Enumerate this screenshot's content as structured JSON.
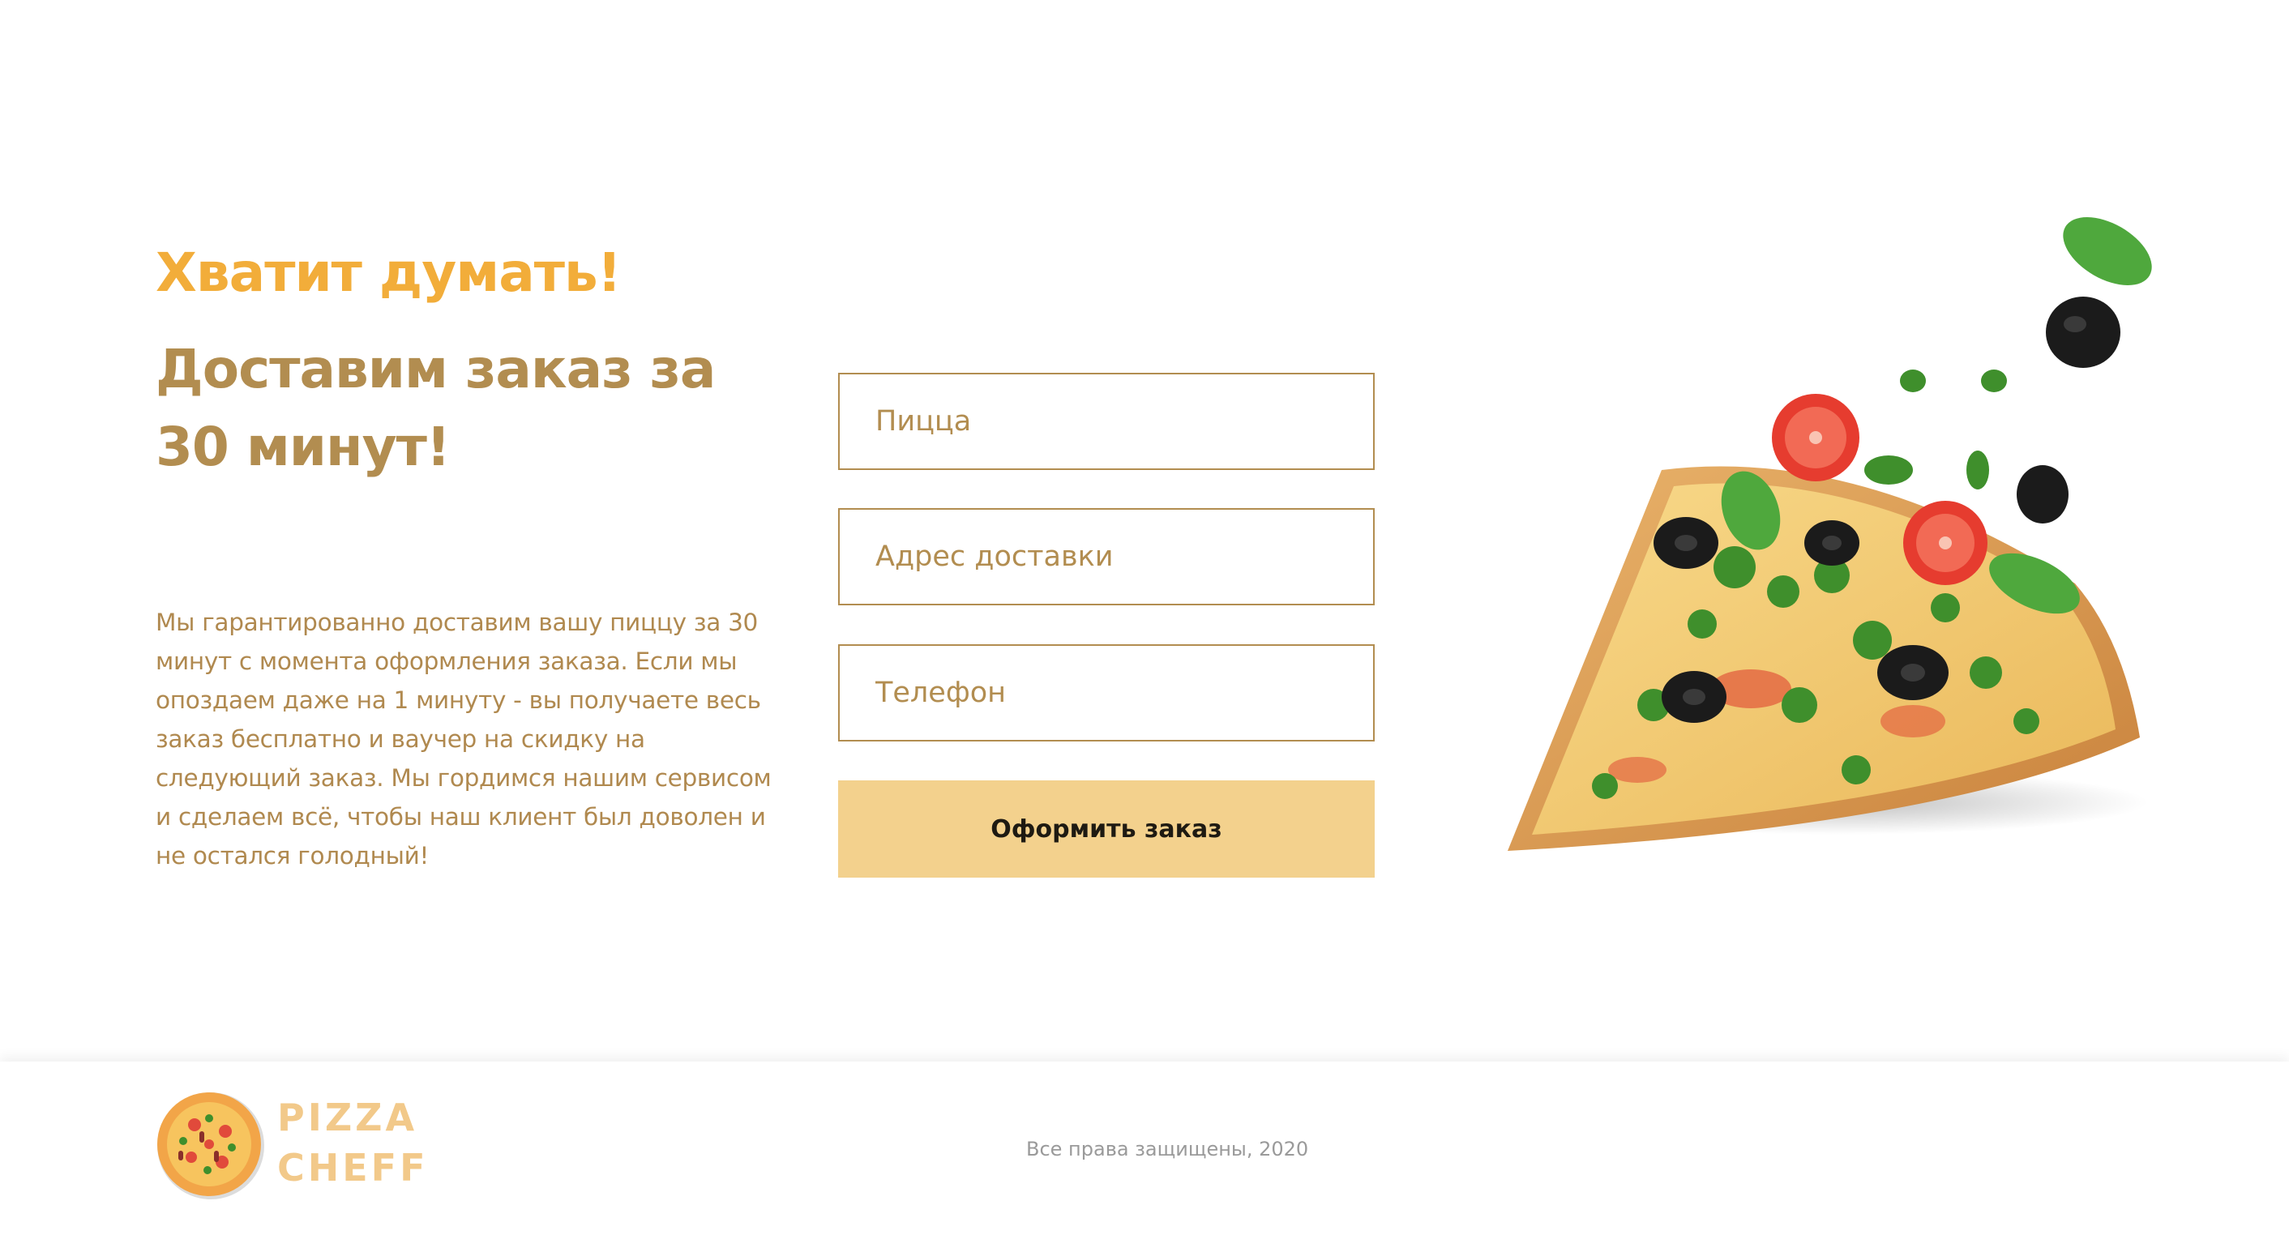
{
  "hero": {
    "headline": "Хватит думать!",
    "subheadline": "Доставим заказ за 30 минут!",
    "description": "Мы гарантированно доставим вашу пиццу за 30 минут с момента оформления заказа. Если мы опоздаем даже на 1 минуту - вы получаете весь заказ бесплатно и ваучер на скидку на следующий заказ. Мы гордимся нашим сервисом и сделаем всё, чтобы наш клиент был доволен и не остался голодный!"
  },
  "form": {
    "pizza_placeholder": "Пицца",
    "pizza_value": "",
    "address_placeholder": "Адрес доставки",
    "address_value": "",
    "phone_placeholder": "Телефон",
    "phone_value": "",
    "submit_label": "Оформить заказ"
  },
  "footer": {
    "logo_line_1": "PIZZA",
    "logo_line_2": "CHEFF",
    "copyright": "Все права защищены, 2020"
  },
  "icons": {
    "logo": "pizza-logo-icon",
    "hero_image": "pizza-slice-image"
  },
  "colors": {
    "accent": "#f2ad3a",
    "brown": "#b28d50",
    "button": "#f3d18d",
    "logo_text": "#f2c98a"
  }
}
